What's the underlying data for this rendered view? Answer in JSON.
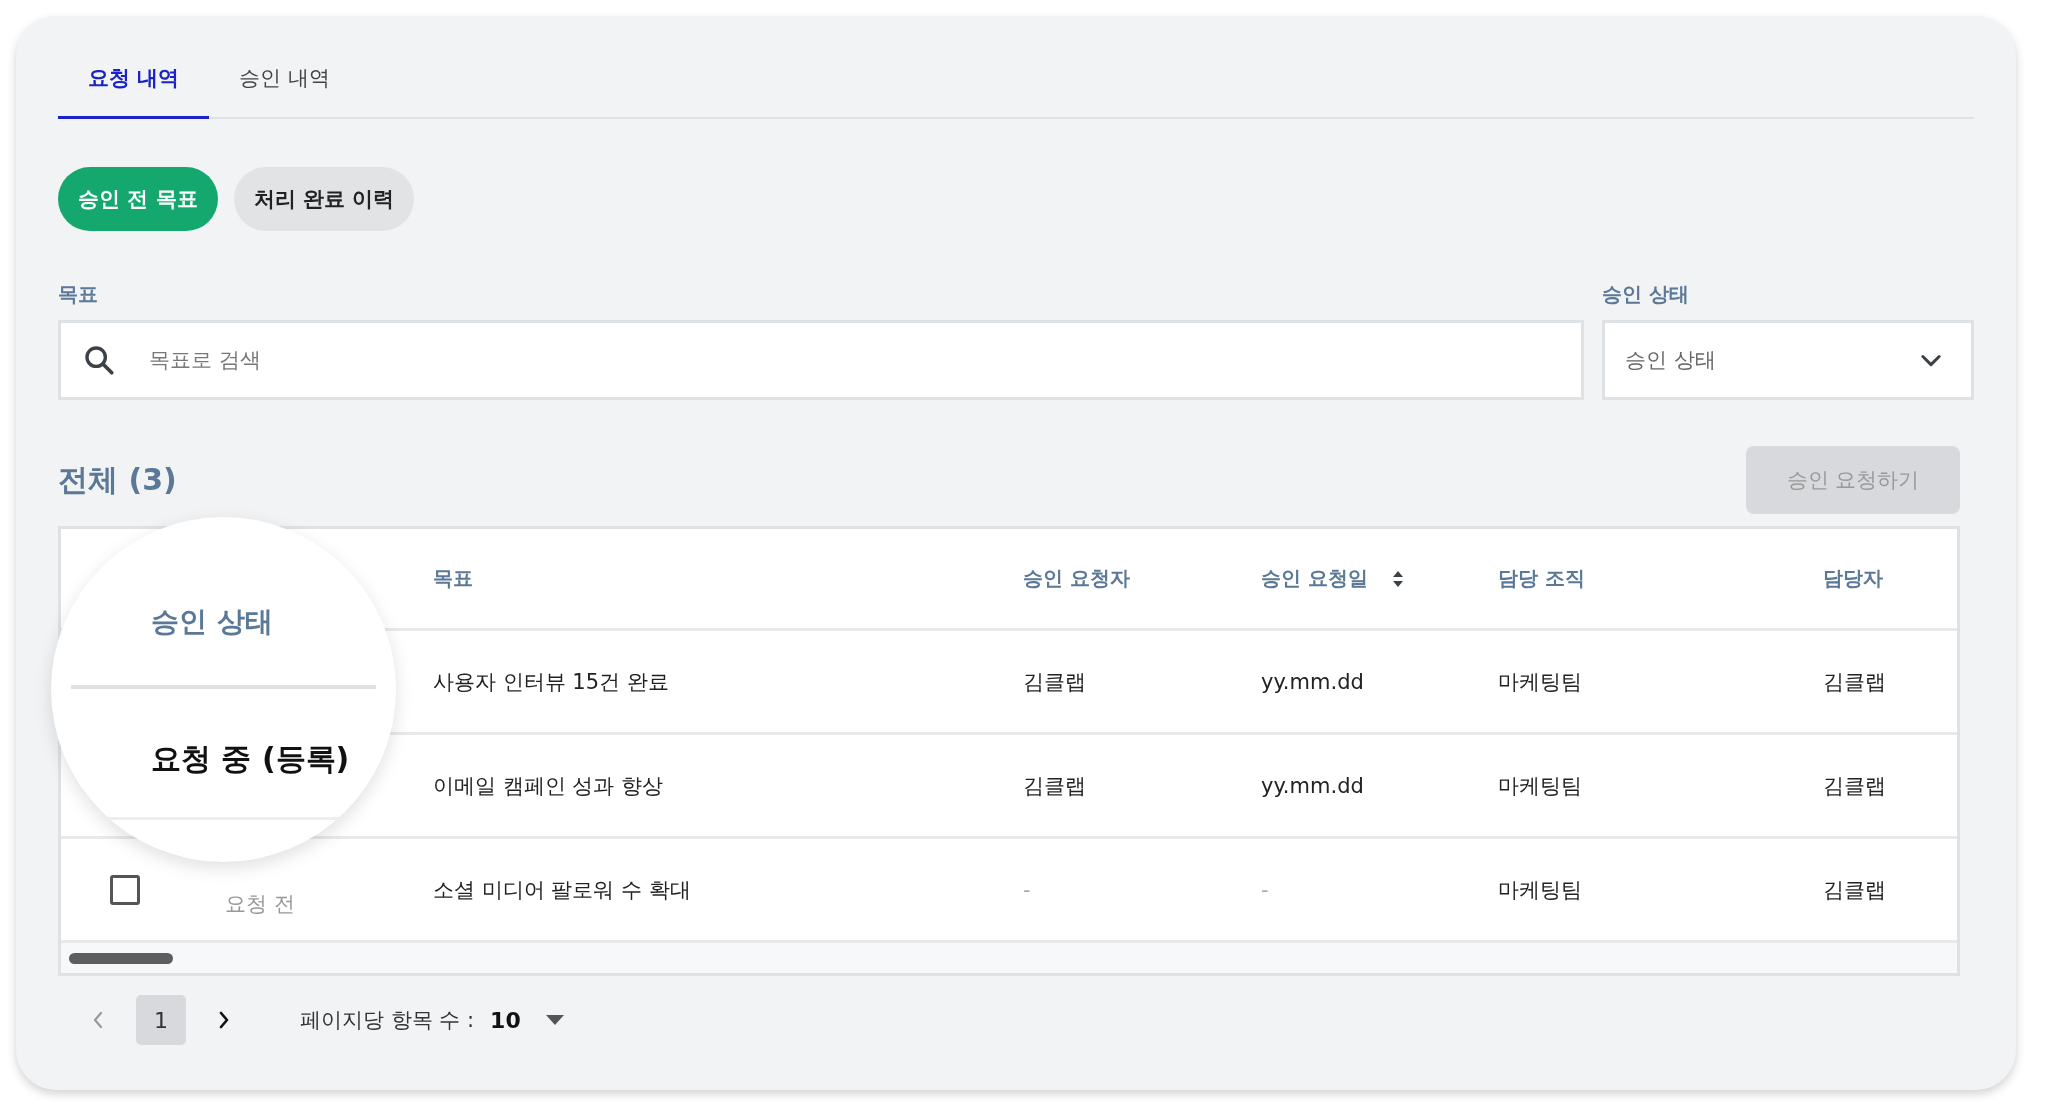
{
  "tabs": [
    {
      "label": "요청 내역",
      "selected": true
    },
    {
      "label": "승인 내역",
      "selected": false
    }
  ],
  "chips": [
    {
      "label": "승인 전 목표",
      "selected": true
    },
    {
      "label": "처리 완료 이력",
      "selected": false
    }
  ],
  "filters": {
    "goal_label": "목표",
    "search": {
      "placeholder": "목표로 검색"
    },
    "status_label": "승인 상태",
    "status_select": {
      "placeholder": "승인 상태"
    }
  },
  "total": "전체 (3)",
  "request_button": {
    "label": "승인 요청하기",
    "disabled": true
  },
  "table": {
    "columns": [
      {
        "label": "목표"
      },
      {
        "label": "승인 요청자"
      },
      {
        "label": "승인 요청일",
        "sortable": true
      },
      {
        "label": "담당 조직"
      },
      {
        "label": "담당자"
      }
    ],
    "rows": [
      {
        "cells": [
          "사용자 인터뷰 15건 완료",
          "김클랩",
          "yy.mm.dd",
          "마케팅팀",
          "김클랩"
        ]
      },
      {
        "cells": [
          "이메일 캠페인 성과 향상",
          "김클랩",
          "yy.mm.dd",
          "마케팅팀",
          "김클랩"
        ]
      },
      {
        "checked": false,
        "status": "요청 전",
        "cells": [
          "소셜 미디어 팔로워 수 확대",
          "-",
          "-",
          "마케팅팀",
          "김클랩"
        ]
      }
    ]
  },
  "magnifier": {
    "header": "승인 상태",
    "value": "요청 중 (등록)"
  },
  "pagination": {
    "prev_disabled": true,
    "next_disabled": false,
    "pages": [
      {
        "label": "1",
        "selected": true
      }
    ],
    "per_page_label": "페이지당 항목 수 :",
    "per_page_value": "10"
  }
}
